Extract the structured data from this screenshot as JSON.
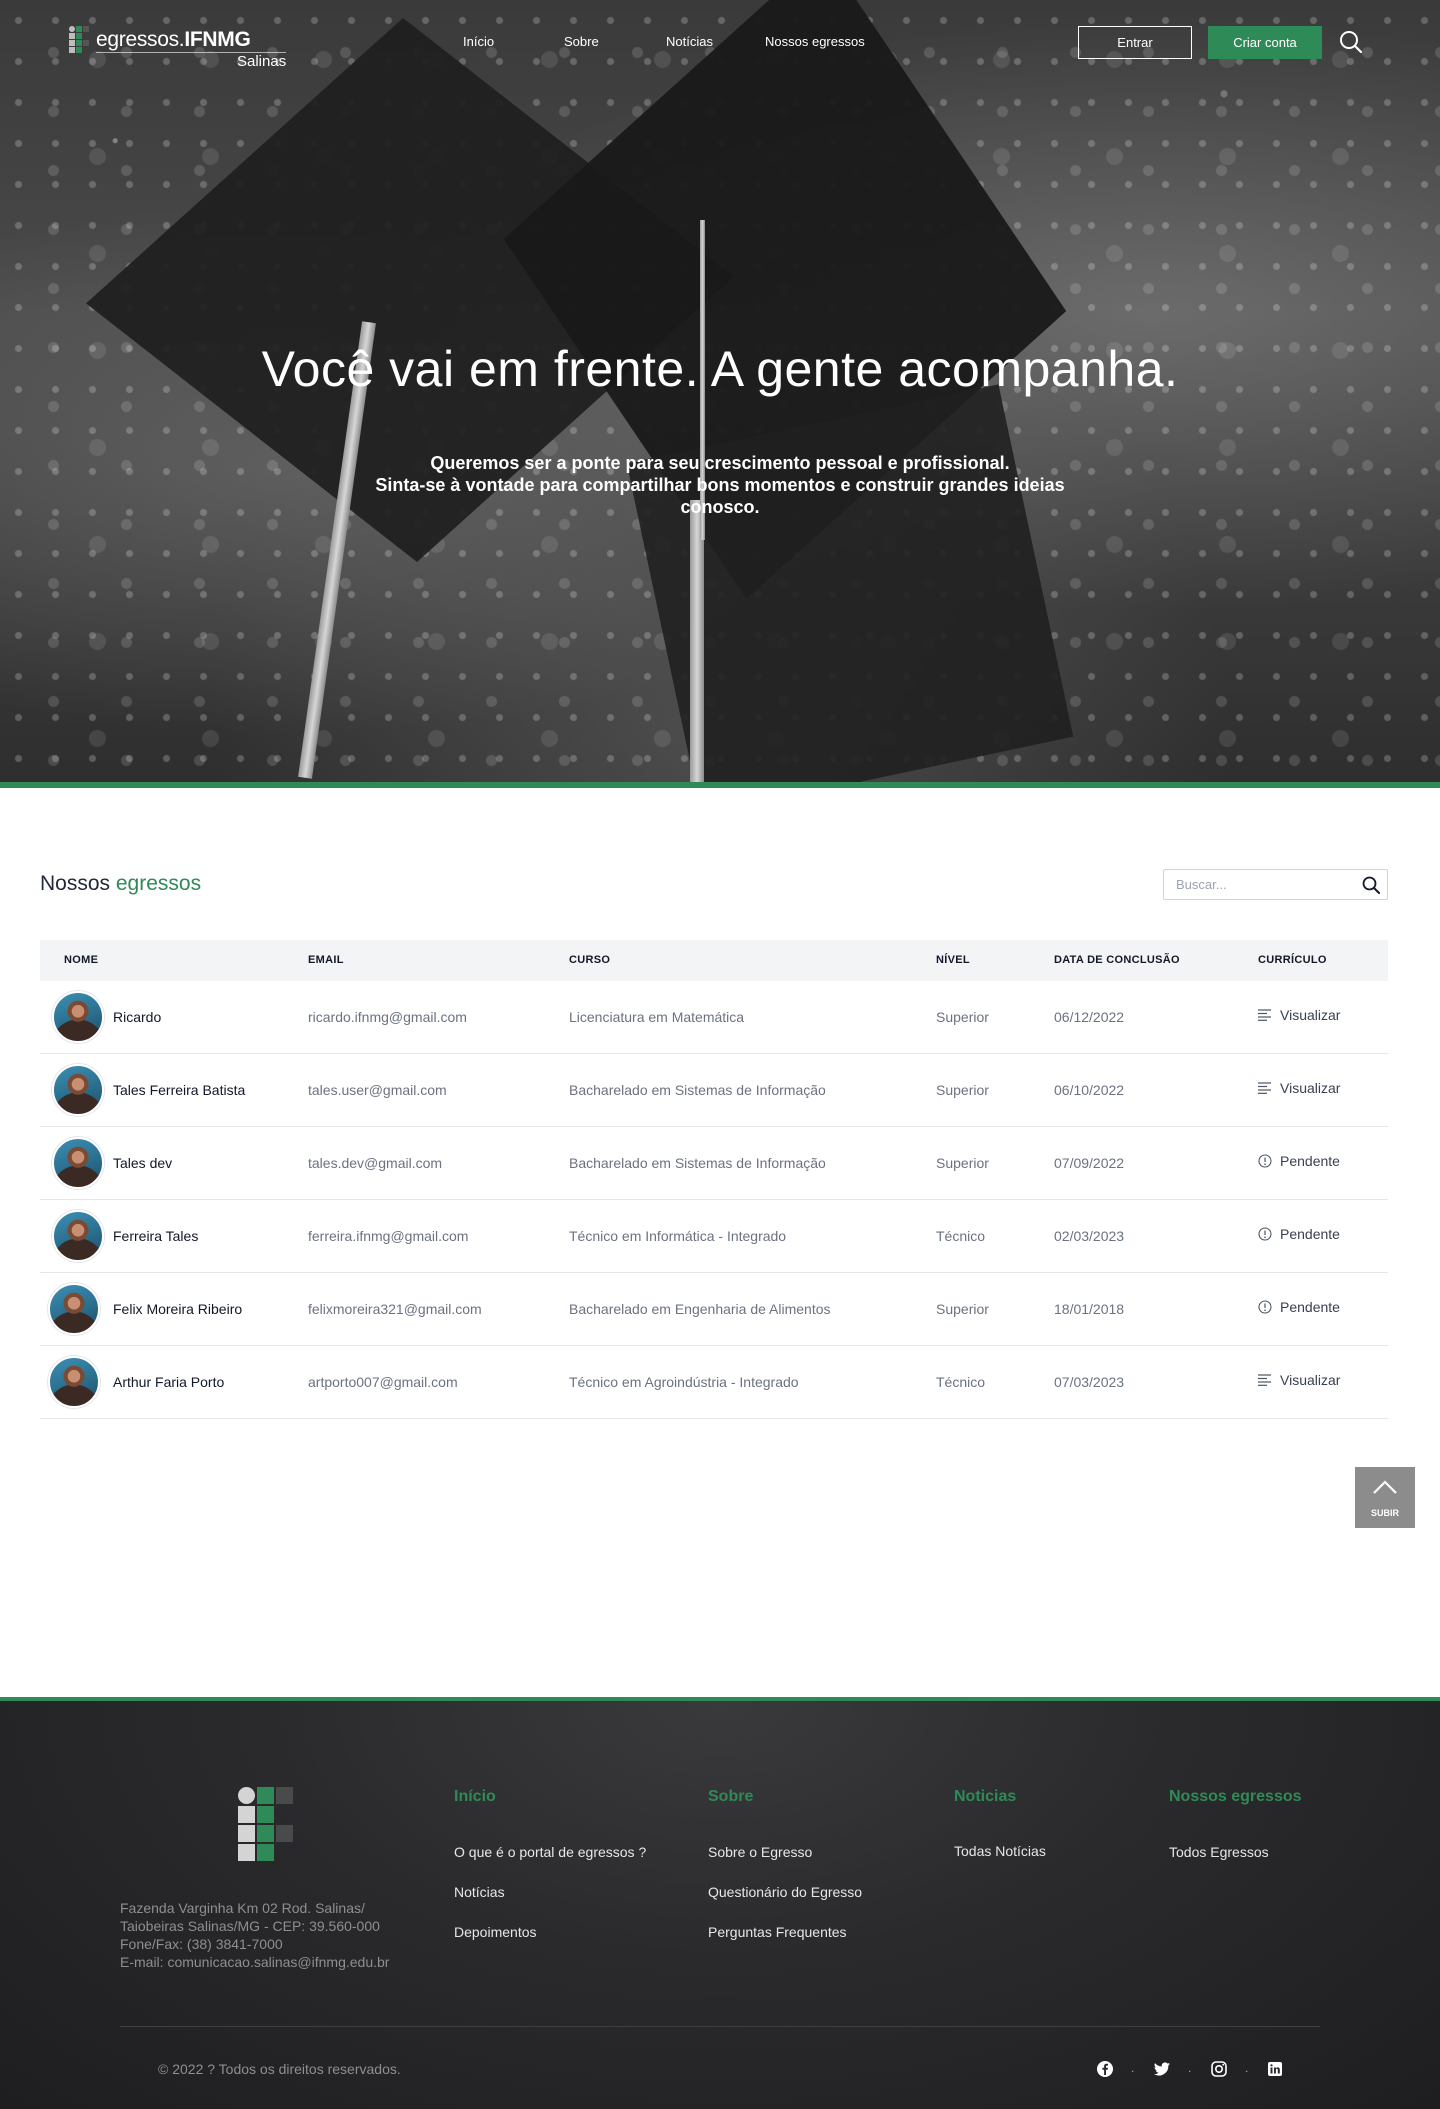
{
  "brand": {
    "name_light": "egressos.",
    "name_bold": "IFNMG",
    "campus": "Salinas",
    "colors": {
      "green": "#2e8b57",
      "dark": "#1e1e20",
      "gray_square": "#bdbdbd"
    }
  },
  "nav": {
    "links": [
      "Início",
      "Sobre",
      "Notícias",
      "Nossos egressos"
    ],
    "login_label": "Entrar",
    "signup_label": "Criar conta",
    "search_icon": "search-icon"
  },
  "hero": {
    "title": "Você vai em frente. A gente acompanha.",
    "subtitle_line1": "Queremos ser a ponte para seu crescimento pessoal e profissional.",
    "subtitle_line2": "Sinta-se à vontade para compartilhar bons momentos e construir grandes ideias conosco."
  },
  "section": {
    "title_plain": "Nossos ",
    "title_accent": "egressos",
    "search_placeholder": "Buscar..."
  },
  "table": {
    "headers": [
      "NOME",
      "EMAIL",
      "CURSO",
      "NÍVEL",
      "DATA DE CONCLUSÃO",
      "CURRÍCULO"
    ],
    "rows": [
      {
        "name": "Ricardo",
        "email": "ricardo.ifnmg@gmail.com",
        "course": "Licenciatura em Matemática",
        "level": "Superior",
        "date": "06/12/2022",
        "cv": "Visualizar",
        "cv_icon": "list-icon"
      },
      {
        "name": "Tales Ferreira Batista",
        "email": "tales.user@gmail.com",
        "course": "Bacharelado em Sistemas de Informação",
        "level": "Superior",
        "date": "06/10/2022",
        "cv": "Visualizar",
        "cv_icon": "list-icon"
      },
      {
        "name": "Tales dev",
        "email": "tales.dev@gmail.com",
        "course": "Bacharelado em Sistemas de Informação",
        "level": "Superior",
        "date": "07/09/2022",
        "cv": "Pendente",
        "cv_icon": "info-icon"
      },
      {
        "name": "Ferreira Tales",
        "email": "ferreira.ifnmg@gmail.com",
        "course": "Técnico em Informática - Integrado",
        "level": "Técnico",
        "date": "02/03/2023",
        "cv": "Pendente",
        "cv_icon": "info-icon"
      },
      {
        "name": "Felix Moreira Ribeiro",
        "email": "felixmoreira321@gmail.com",
        "course": "Bacharelado em Engenharia de Alimentos",
        "level": "Superior",
        "date": "18/01/2018",
        "cv": "Pendente",
        "cv_icon": "info-icon"
      },
      {
        "name": "Arthur Faria Porto",
        "email": "artporto007@gmail.com",
        "course": "Técnico em Agroindústria - Integrado",
        "level": "Técnico",
        "date": "07/03/2023",
        "cv": "Visualizar",
        "cv_icon": "list-icon"
      }
    ]
  },
  "to_top": {
    "label": "SUBIR"
  },
  "footer": {
    "address_lines": [
      "Fazenda Varginha Km 02 Rod. Salinas/",
      "Taiobeiras Salinas/MG - CEP: 39.560-000",
      "Fone/Fax: (38) 3841-7000",
      "E-mail: comunicacao.salinas@ifnmg.edu.br"
    ],
    "columns": [
      {
        "heading": "Início",
        "links": [
          "O que é o portal de egressos ?",
          "Notícias",
          "Depoimentos"
        ]
      },
      {
        "heading": "Sobre",
        "links": [
          "Sobre o Egresso",
          "Questionário do Egresso",
          "Perguntas Frequentes"
        ]
      },
      {
        "heading": "Noticias",
        "links": [
          "Todas Notícias"
        ]
      },
      {
        "heading": "Nossos egressos",
        "links": [
          "Todos Egressos"
        ]
      }
    ],
    "copyright": "© 2022 ? Todos os direitos reservados.",
    "social": [
      "facebook-icon",
      "twitter-icon",
      "instagram-icon",
      "linkedin-icon"
    ]
  }
}
